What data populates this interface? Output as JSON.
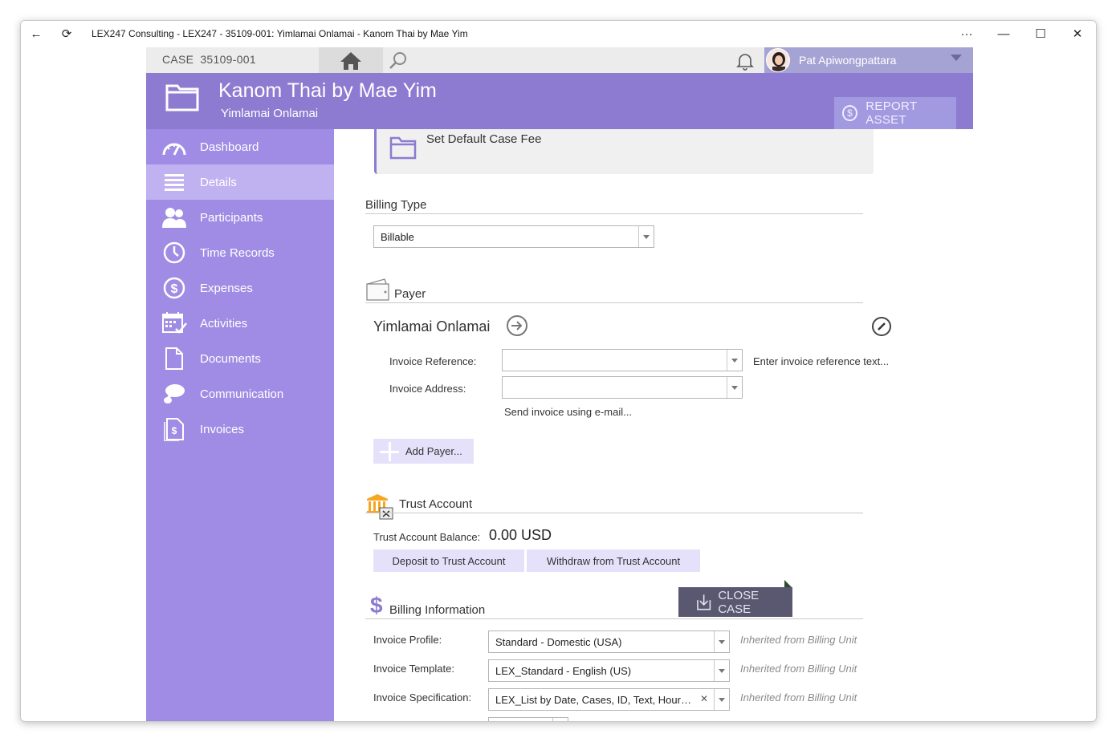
{
  "window": {
    "title": "LEX247 Consulting - LEX247 - 35109-001: Yimlamai Onlamai - Kanom Thai by Mae Yim",
    "back_glyph": "←",
    "refresh_glyph": "⟳",
    "more_glyph": "···",
    "minimize_glyph": "—",
    "maximize_glyph": "☐",
    "close_glyph": "✕"
  },
  "topbar": {
    "case_label": "CASE",
    "case_number": "35109-001",
    "user_name": "Pat Apiwongpattara"
  },
  "header": {
    "title": "Kanom Thai by Mae Yim",
    "subtitle": "Yimlamai Onlamai",
    "report_asset_label": "REPORT ASSET",
    "report_asset_icon": "$"
  },
  "sidebar": {
    "items": [
      {
        "label": "Dashboard",
        "icon": "gauge-icon"
      },
      {
        "label": "Details",
        "icon": "list-icon"
      },
      {
        "label": "Participants",
        "icon": "people-icon"
      },
      {
        "label": "Time Records",
        "icon": "clock-icon"
      },
      {
        "label": "Expenses",
        "icon": "dollar-circle-icon"
      },
      {
        "label": "Activities",
        "icon": "calendar-icon"
      },
      {
        "label": "Documents",
        "icon": "document-icon"
      },
      {
        "label": "Communication",
        "icon": "chat-icon"
      },
      {
        "label": "Invoices",
        "icon": "invoice-icon"
      }
    ]
  },
  "main": {
    "default_fee": {
      "label": "Set Default Case Fee"
    },
    "billing_type": {
      "title": "Billing Type",
      "value": "Billable"
    },
    "payer": {
      "title": "Payer",
      "name": "Yimlamai Onlamai",
      "invoice_reference_label": "Invoice Reference:",
      "invoice_reference_value": "",
      "invoice_reference_hint": "Enter invoice reference text...",
      "invoice_address_label": "Invoice Address:",
      "invoice_address_value": "",
      "send_email_hint": "Send invoice using e-mail...",
      "add_payer_label": "Add Payer..."
    },
    "trust": {
      "title": "Trust Account",
      "balance_label": "Trust Account Balance:",
      "balance_value": "0.00 USD",
      "deposit_label": "Deposit to Trust Account",
      "withdraw_label": "Withdraw from Trust Account"
    },
    "billing_info": {
      "title": "Billing Information",
      "dollar_glyph": "$",
      "rows": [
        {
          "label": "Invoice Profile:",
          "value": "Standard - Domestic (USA)",
          "note": "Inherited from Billing Unit"
        },
        {
          "label": "Invoice Template:",
          "value": "LEX_Standard - English (US)",
          "note": "Inherited from Billing Unit"
        },
        {
          "label": "Invoice Specification:",
          "value": "LEX_List by Date, Cases, ID, Text, Hours, ...",
          "note": "Inherited from Billing Unit",
          "clear_glyph": "✕"
        }
      ]
    },
    "close_case_label": "CLOSE CASE"
  },
  "colors": {
    "header": "#8c7bd0",
    "sidebar": "#a08ce4",
    "sidebar_active": "#c0b2f0",
    "user_area": "#a5a2d4",
    "button_light": "#e6e1fa",
    "close_case": "#5a5770"
  }
}
